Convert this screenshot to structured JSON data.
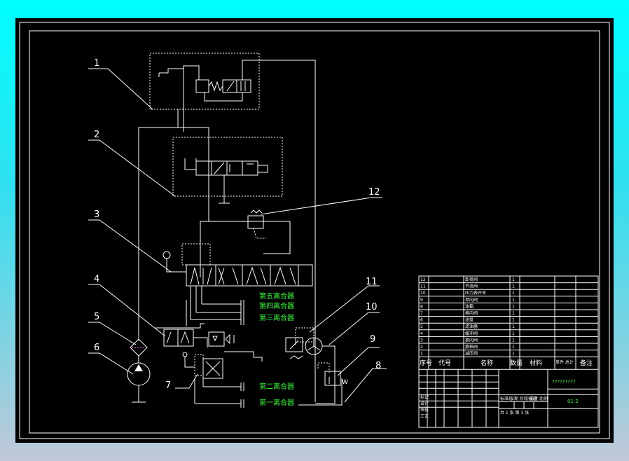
{
  "labels": [
    "1",
    "2",
    "3",
    "4",
    "5",
    "6",
    "7",
    "8",
    "9",
    "10",
    "11",
    "12"
  ],
  "couplers": {
    "c5": "第五离合器",
    "c4": "第四离合器",
    "c3": "第三离合器",
    "c2": "第二离合器",
    "c1": "第一离合器"
  },
  "spring_symbol": "W",
  "title_block": {
    "rows": [
      {
        "no": "12",
        "name": "卸荷阀",
        "qty": "1"
      },
      {
        "no": "11",
        "name": "节流阀",
        "qty": "1"
      },
      {
        "no": "10",
        "name": "压力表开关",
        "qty": "1"
      },
      {
        "no": "9",
        "name": "单向阀",
        "qty": "1"
      },
      {
        "no": "8",
        "name": "油箱",
        "qty": "1"
      },
      {
        "no": "7",
        "name": "换向阀",
        "qty": "1"
      },
      {
        "no": "6",
        "name": "油泵",
        "qty": "1"
      },
      {
        "no": "5",
        "name": "滤油器",
        "qty": "1"
      },
      {
        "no": "4",
        "name": "缓冲阀",
        "qty": "1"
      },
      {
        "no": "3",
        "name": "换向阀",
        "qty": "1"
      },
      {
        "no": "2",
        "name": "换档阀",
        "qty": "1"
      },
      {
        "no": "1",
        "name": "减压阀",
        "qty": "1"
      }
    ],
    "header": {
      "seq": "序号",
      "code": "代号",
      "name": "名称",
      "qty": "数量",
      "material": "材料",
      "weight": "单件 总计",
      "remark": "备注"
    },
    "drawing_name": "?????????",
    "drawing_no": "01-2",
    "left_labels": [
      "标记",
      "设计",
      "审核",
      "工艺"
    ],
    "mid_labels": [
      "标准化",
      "日期",
      "阶段标记",
      "重量",
      "比例"
    ],
    "sheet": "共 1 张  第 1 张"
  }
}
